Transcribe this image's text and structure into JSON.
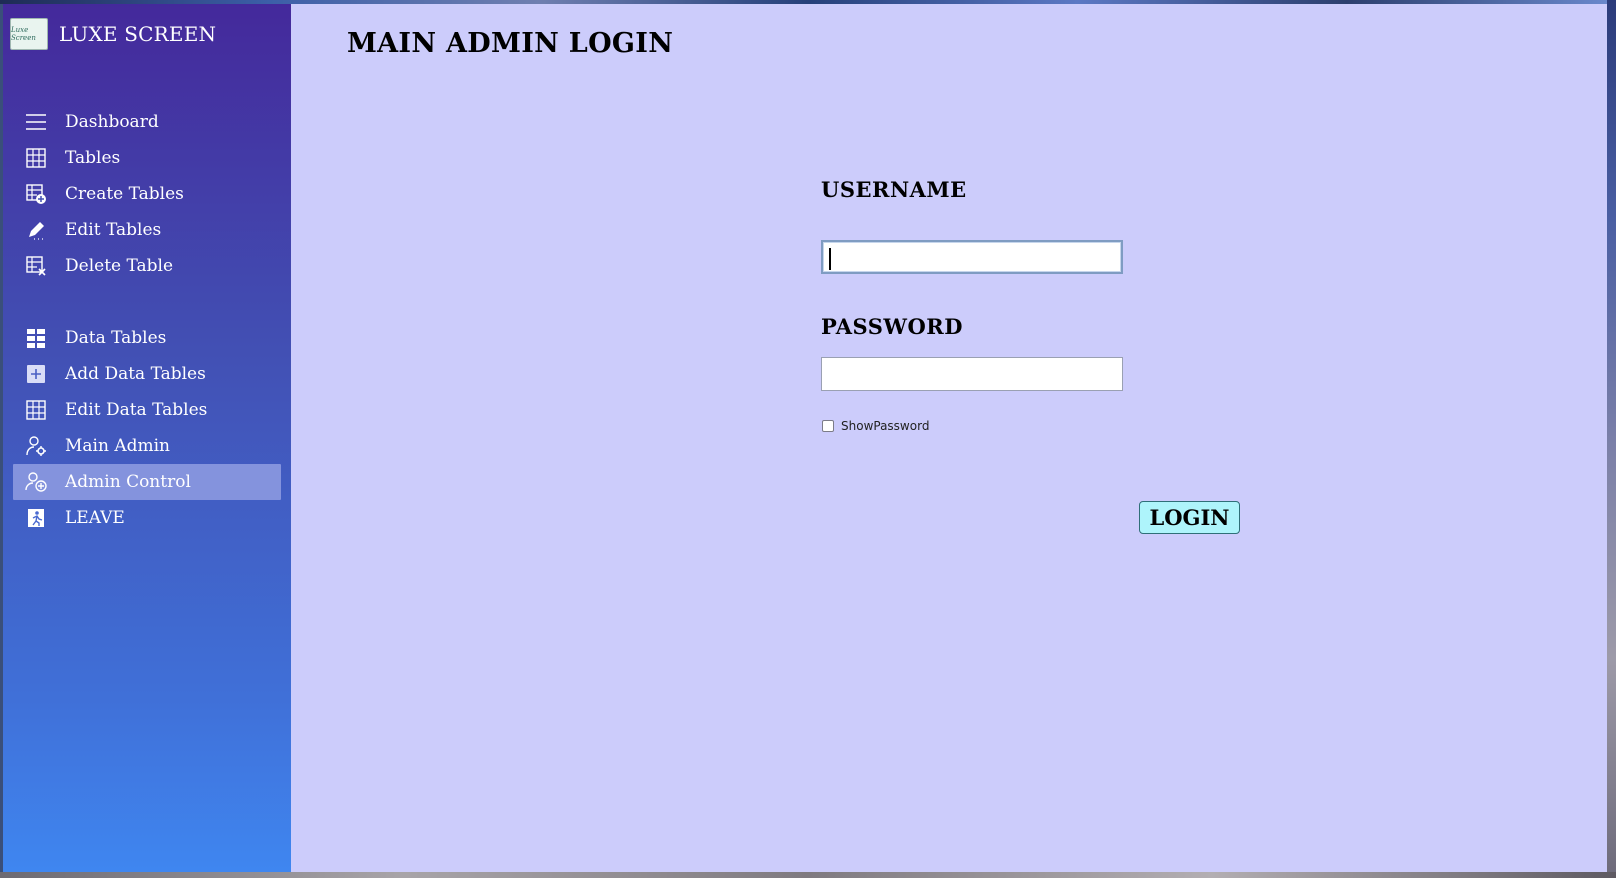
{
  "app": {
    "brand_name": "LUXE SCREEN",
    "logo_text": "Luxe Screen"
  },
  "sidebar": {
    "items": [
      {
        "label": "Dashboard",
        "icon": "menu-icon"
      },
      {
        "label": "Tables",
        "icon": "grid-icon"
      },
      {
        "label": "Create Tables",
        "icon": "table-add-icon"
      },
      {
        "label": "Edit Tables",
        "icon": "pencil-icon"
      },
      {
        "label": "Delete Table",
        "icon": "table-delete-icon"
      },
      {
        "label": "Data Tables",
        "icon": "grid-filled-icon"
      },
      {
        "label": "Add Data Tables",
        "icon": "plus-square-icon"
      },
      {
        "label": "Edit Data Tables",
        "icon": "grid-icon"
      },
      {
        "label": "Main Admin",
        "icon": "user-gear-icon"
      },
      {
        "label": "Admin Control",
        "icon": "user-add-icon",
        "active": true
      },
      {
        "label": "LEAVE",
        "icon": "exit-icon"
      }
    ]
  },
  "main": {
    "title": "MAIN ADMIN LOGIN",
    "username_label": "USERNAME",
    "username_value": "",
    "password_label": "PASSWORD",
    "password_value": "",
    "show_password_label": "ShowPassword",
    "show_password_checked": false,
    "login_label": "LOGIN"
  },
  "colors": {
    "sidebar_top": "#44299b",
    "sidebar_bottom": "#3f86f0",
    "active_item": "#8493dd",
    "main_background": "#ccccfb",
    "login_button": "#aef4fb"
  }
}
